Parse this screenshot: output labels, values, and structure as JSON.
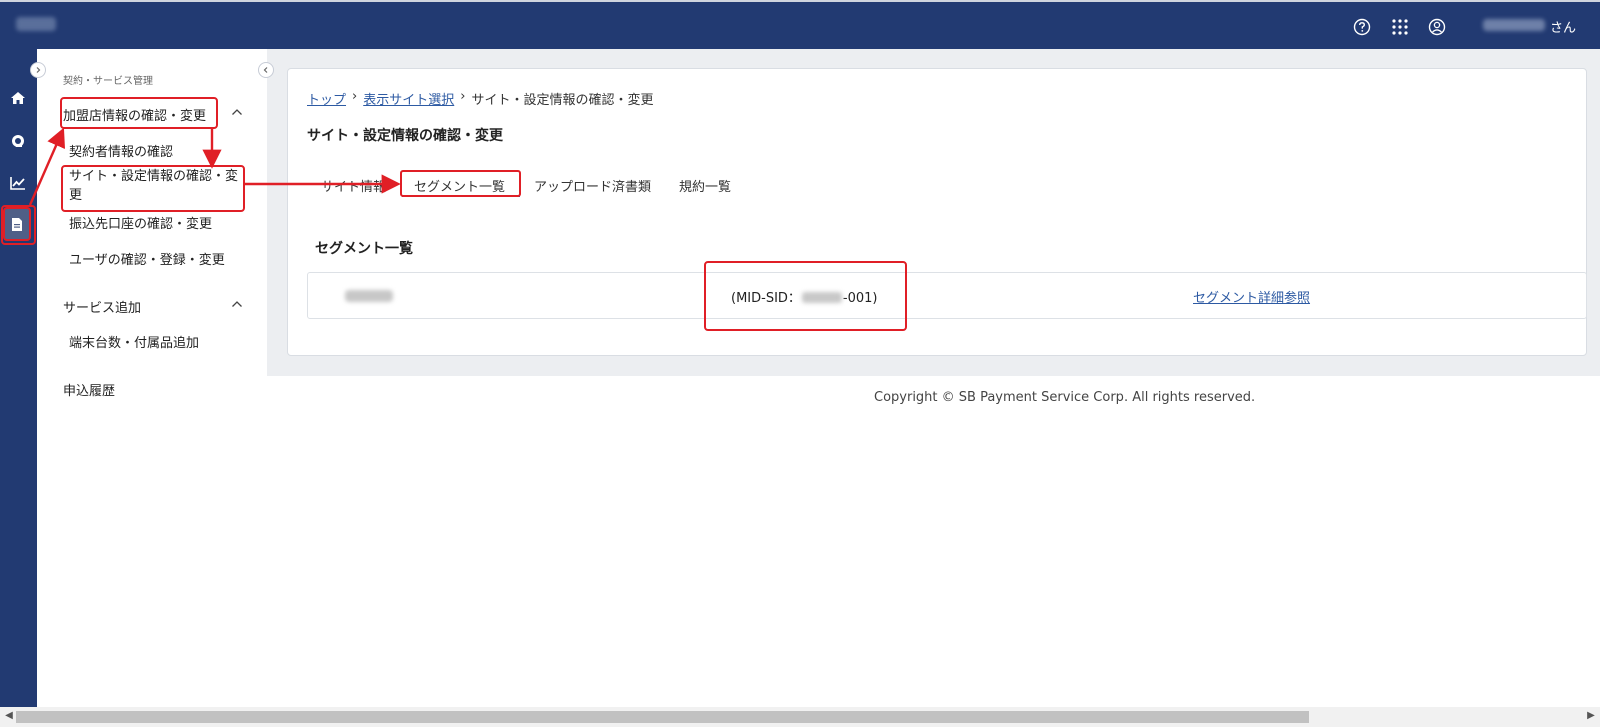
{
  "topbar": {
    "brand": "",
    "user_suffix": "さん",
    "icons": [
      "help-icon",
      "apps-grid-icon",
      "user-icon"
    ]
  },
  "rail": {
    "items": [
      "home-icon",
      "support-icon",
      "chart-icon",
      "document-icon"
    ],
    "active": "document-icon"
  },
  "sidebar": {
    "caption": "契約・サービス管理",
    "groups": [
      {
        "label": "加盟店情報の確認・変更",
        "items": [
          "契約者情報の確認",
          "サイト・設定情報の確認・変更",
          "振込先口座の確認・変更",
          "ユーザの確認・登録・変更"
        ]
      },
      {
        "label": "サービス追加",
        "items": [
          "端末台数・付属品追加"
        ]
      }
    ],
    "history": "申込履歴"
  },
  "breadcrumb": {
    "items": [
      "トップ",
      "表示サイト選択",
      "サイト・設定情報の確認・変更"
    ],
    "sep": "›"
  },
  "page": {
    "title": "サイト・設定情報の確認・変更"
  },
  "tabs": {
    "items": [
      "サイト情報",
      "セグメント一覧",
      "アップロード済書類",
      "規約一覧"
    ],
    "active": "セグメント一覧"
  },
  "segments": {
    "title": "セグメント一覧",
    "row": {
      "mid_prefix": "(MID-SID：",
      "mid_suffix": "-001)",
      "link": "セグメント詳細参照"
    }
  },
  "footer": {
    "copyright": "Copyright © SB Payment Service Corp. All rights reserved."
  },
  "colors": {
    "navy": "#223a72",
    "highlight": "#e01f26",
    "link": "#2d5aa3"
  }
}
